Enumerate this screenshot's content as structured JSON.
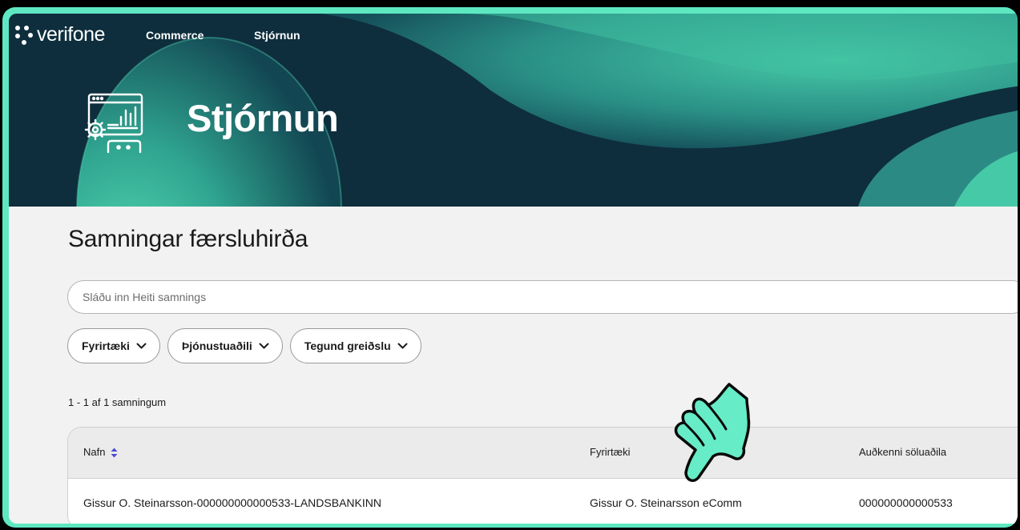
{
  "brand": {
    "name": "verifone"
  },
  "nav": {
    "items": [
      {
        "label": "Commerce"
      },
      {
        "label": "Stjórnun"
      }
    ]
  },
  "hero": {
    "title": "Stjórnun",
    "icon": "dashboard-settings-icon"
  },
  "page": {
    "title": "Samningar færsluhirða"
  },
  "search": {
    "placeholder": "Sláðu inn Heiti samnings",
    "value": ""
  },
  "filters": [
    {
      "label": "Fyrirtæki",
      "icon": "chevron-down-icon"
    },
    {
      "label": "Þjónustuaðili",
      "icon": "chevron-down-icon"
    },
    {
      "label": "Tegund greiðslu",
      "icon": "chevron-down-icon"
    }
  ],
  "results": {
    "count_text": "1 - 1 af 1 samningum"
  },
  "table": {
    "columns": [
      {
        "label": "Nafn",
        "sort_icon": "sort-icon"
      },
      {
        "label": "Fyrirtæki"
      },
      {
        "label": "Auðkenni söluaðila"
      }
    ],
    "rows": [
      {
        "nafn": "Gissur O. Steinarsson-000000000000533-LANDSBANKINN",
        "fyrirtaeki": "Gissur O. Steinarsson eComm",
        "audkenni": "000000000000533"
      }
    ]
  },
  "colors": {
    "accent": "#5ee8c2",
    "hero_bg": "#0e2e3d",
    "sort_icon": "#4b4bd6",
    "page_bg": "#f2f2f2"
  }
}
